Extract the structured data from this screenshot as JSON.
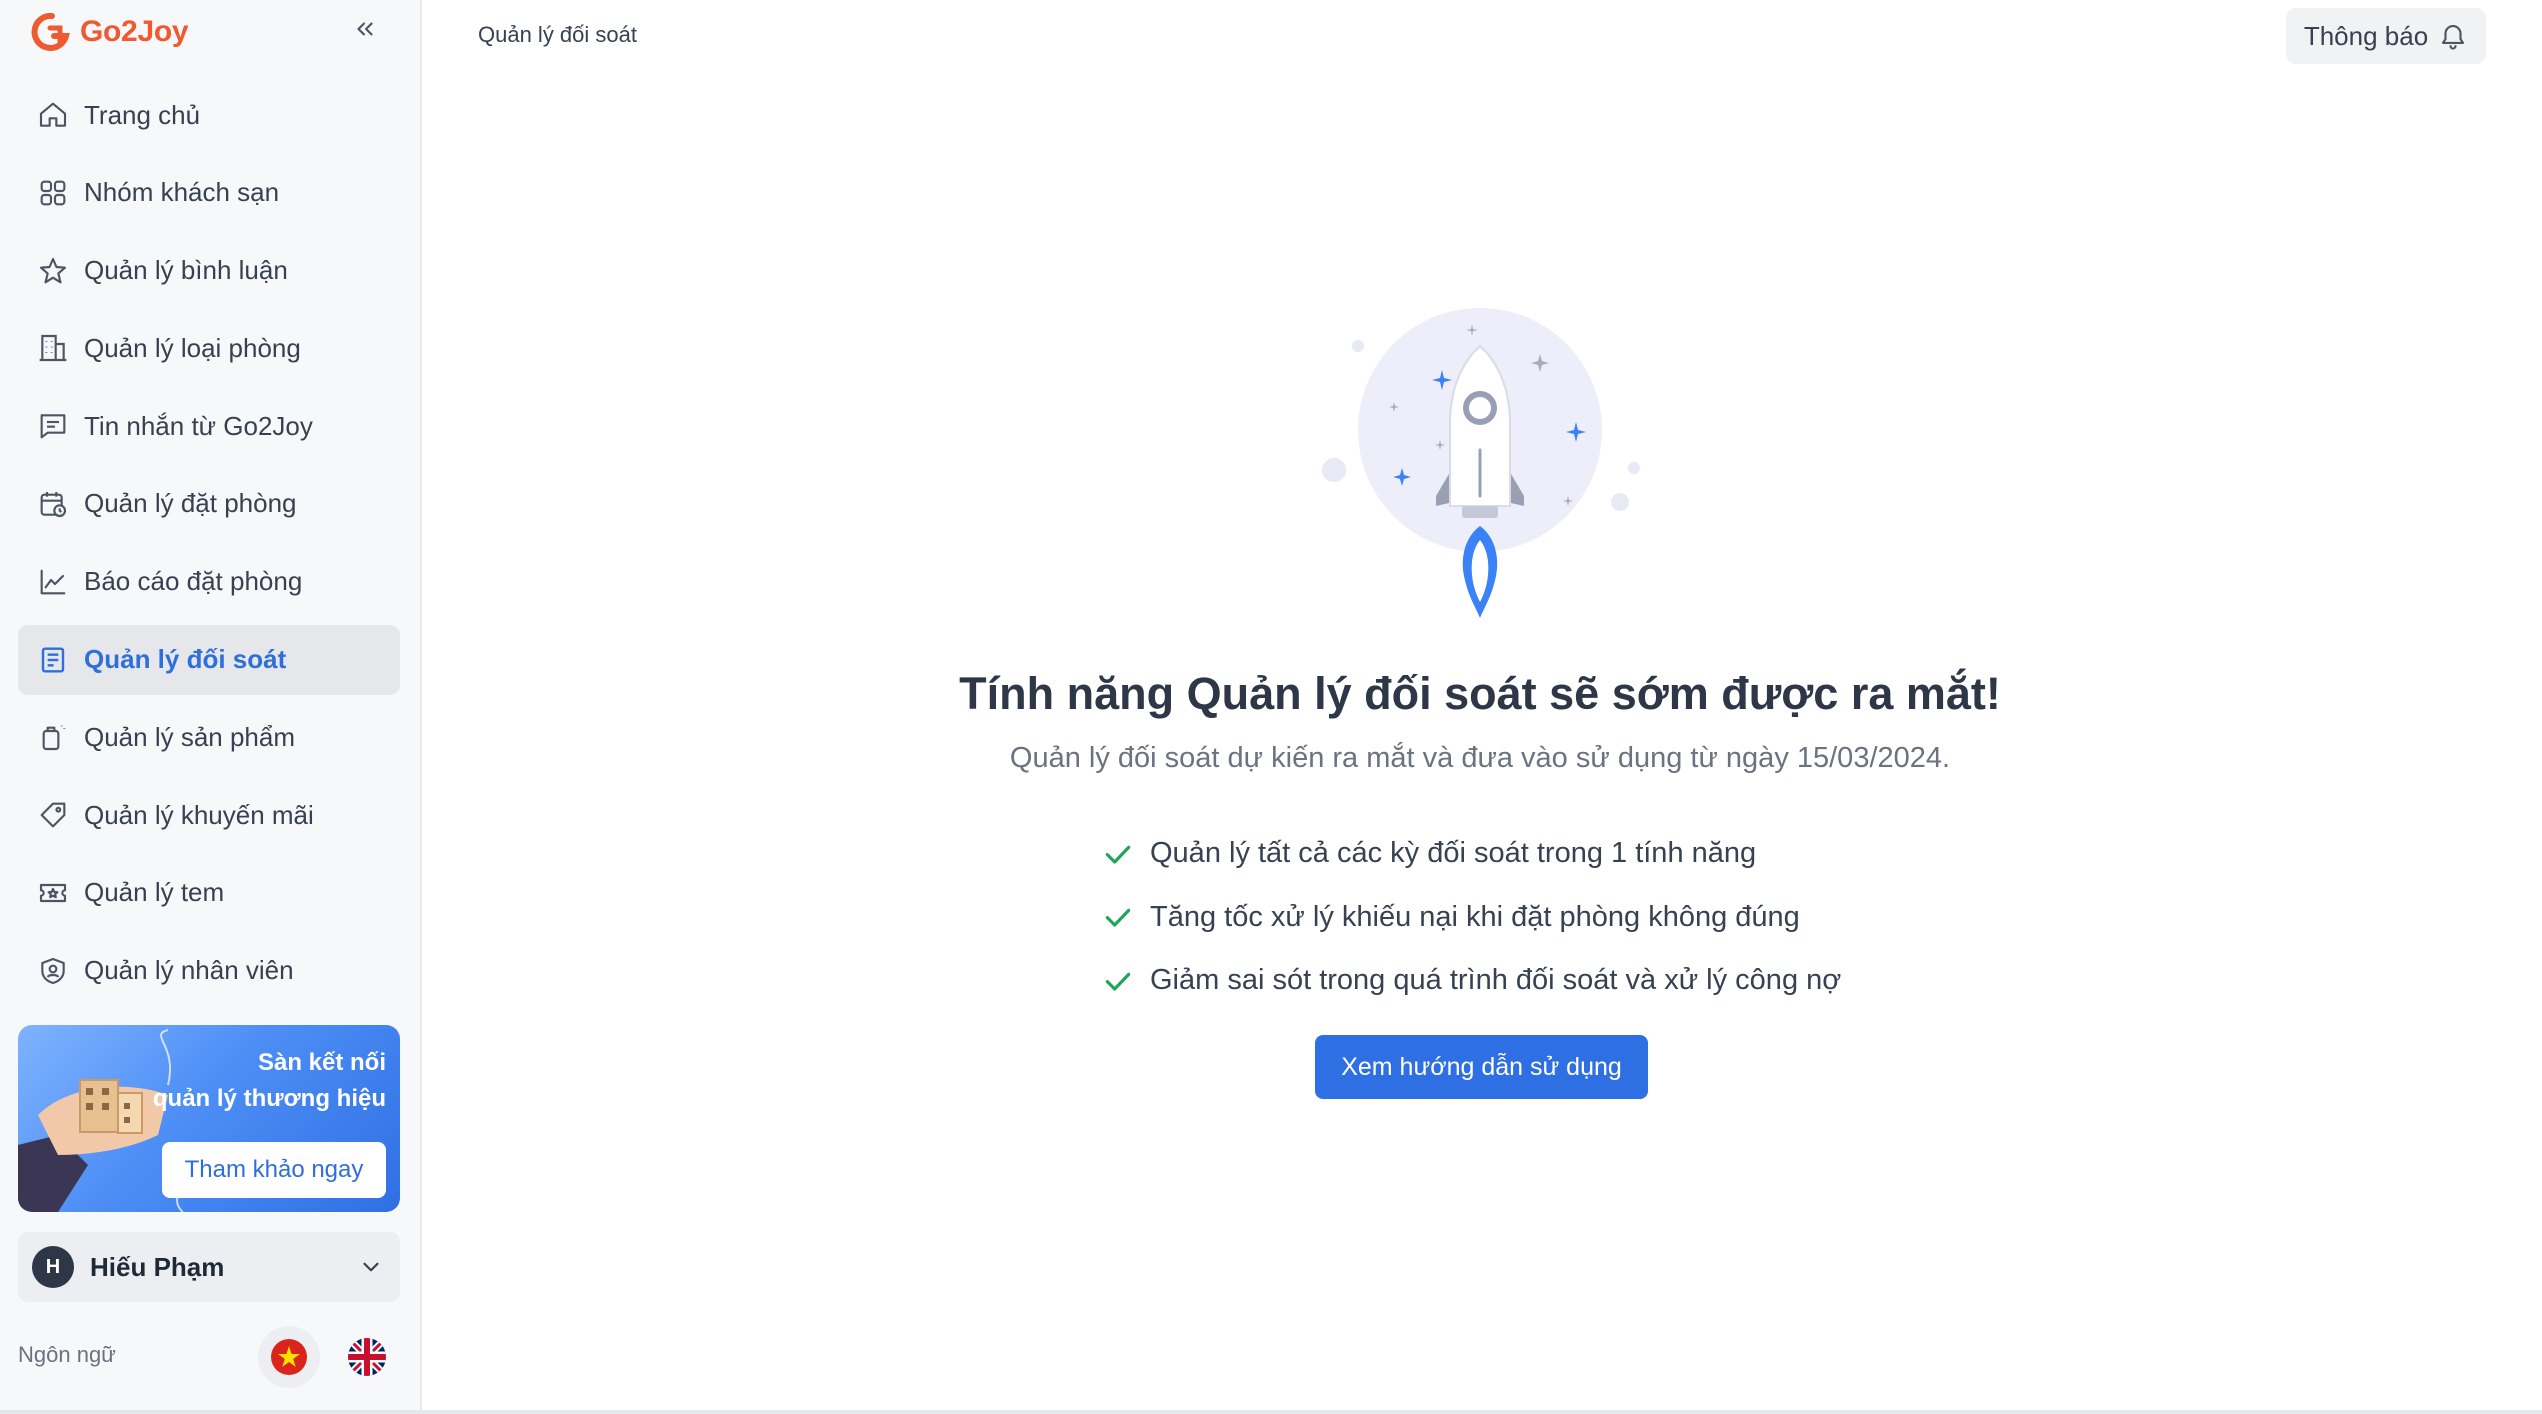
{
  "app": {
    "logo_text": "Go2Joy"
  },
  "sidebar": {
    "items": [
      {
        "label": "Trang chủ",
        "icon": "home-icon",
        "active": false
      },
      {
        "label": "Nhóm khách sạn",
        "icon": "grid-icon",
        "active": false
      },
      {
        "label": "Quản lý bình luận",
        "icon": "star-icon",
        "active": false
      },
      {
        "label": "Quản lý loại phòng",
        "icon": "building-icon",
        "active": false
      },
      {
        "label": "Tin nhắn từ Go2Joy",
        "icon": "message-icon",
        "active": false
      },
      {
        "label": "Quản lý đặt phòng",
        "icon": "calendar-icon",
        "active": false
      },
      {
        "label": "Báo cáo đặt phòng",
        "icon": "chart-line-icon",
        "active": false
      },
      {
        "label": "Quản lý đối soát",
        "icon": "receipt-icon",
        "active": true
      },
      {
        "label": "Quản lý sản phẩm",
        "icon": "product-icon",
        "active": false
      },
      {
        "label": "Quản lý khuyến mãi",
        "icon": "tag-icon",
        "active": false
      },
      {
        "label": "Quản lý tem",
        "icon": "ticket-icon",
        "active": false
      },
      {
        "label": "Quản lý nhân viên",
        "icon": "shield-user-icon",
        "active": false
      }
    ],
    "promo": {
      "line1": "Sàn kết nối",
      "line2": "quản lý thương hiệu",
      "button": "Tham khảo ngay"
    },
    "user": {
      "initial": "H",
      "name": "Hiếu Phạm"
    },
    "language_label": "Ngôn ngữ"
  },
  "header": {
    "breadcrumb": "Quản lý đối soát",
    "notification_label": "Thông báo"
  },
  "main": {
    "headline": "Tính năng Quản lý đối soát sẽ sớm được ra mắt!",
    "subline": "Quản lý đối soát dự kiến ra mắt và đưa vào sử dụng từ ngày 15/03/2024.",
    "features": [
      "Quản lý tất cả các kỳ đối soát trong 1 tính năng",
      "Tăng tốc xử lý khiếu nại khi đặt phòng không đúng",
      "Giảm sai sót trong quá trình đối soát và xử lý công nợ"
    ],
    "cta_label": "Xem hướng dẫn sử dụng"
  },
  "colors": {
    "brand": "#ef5a30",
    "accent": "#2f6fe4",
    "active_text": "#2f6fdb",
    "check": "#22a55b"
  }
}
